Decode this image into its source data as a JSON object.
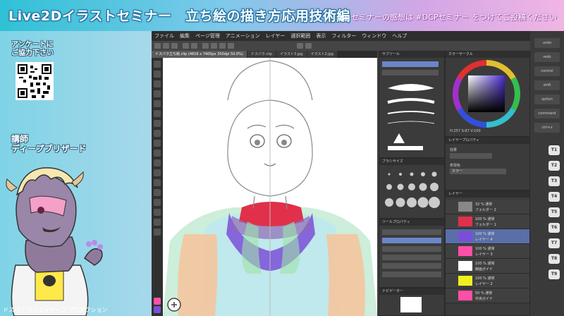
{
  "header": {
    "title": "Live2Dイラストセミナー　立ち絵の描き方応用技術編",
    "hashtag_note": "セミナーの感想は #DCPセミナー をつけてご投稿ください"
  },
  "sidebar": {
    "survey_line1": "アンケートに",
    "survey_line2": "ご協力下さい",
    "instructor_role": "講師",
    "instructor_name": "ディープブリザード",
    "credit": "ドスパラ クリエイティブ プロダクション"
  },
  "app": {
    "menu": [
      "ファイル",
      "編集",
      "ページ管理",
      "アニメーション",
      "レイヤー",
      "選択範囲",
      "表示",
      "フィルター",
      "ウィンドウ",
      "ヘルプ"
    ],
    "tabs": [
      "ドスパラ立ち絵.clip (4816 x 7400px 350dpi 50.0%)",
      "ドスパラ.clip",
      "イラスト3.jpg",
      "イラスト2.jpg"
    ],
    "subtool_title": "サブツール",
    "colorwheel_title": "カラーサークル",
    "color_readout": "H:257 S:87 V:100",
    "brushsize_title": "ブラシサイズ",
    "layer_property_title": "レイヤープロパティ",
    "effect_label": "効果",
    "expression_color_label": "表現色",
    "expression_color_value": "カラー",
    "tool_property_title": "ツールプロパティ",
    "layer_panel_title": "レイヤー",
    "navigator_title": "ナビゲーター",
    "layers": [
      {
        "name": "32 % 通常",
        "sub": "フォルダー 2"
      },
      {
        "name": "100 % 通常",
        "sub": "フォルダー 1"
      },
      {
        "name": "100 % 通常",
        "sub": "レイヤー 4"
      },
      {
        "name": "100 % 通常",
        "sub": "レイヤー 3"
      },
      {
        "name": "100 % 通常",
        "sub": "線画ガイド"
      },
      {
        "name": "100 % 通常",
        "sub": "レイヤー 2"
      },
      {
        "name": "50 % 通常",
        "sub": "中央ガイド"
      }
    ]
  },
  "right_strip": {
    "buttons": [
      "undo",
      "redo",
      "control",
      "shift",
      "option",
      "command",
      "ctrl+z"
    ],
    "tabs": [
      "T1",
      "T2",
      "T3",
      "T4",
      "T5",
      "T6",
      "T7",
      "T8",
      "T9"
    ]
  },
  "colors": {
    "title_stroke": "#1d6c9c",
    "hood_red": "#e0304a",
    "hood_purple": "#7a4fd8",
    "accent_pink": "#ff4fa8",
    "accent_yellow": "#f0f020",
    "color_wheel_selected": "#4a2cd0"
  }
}
